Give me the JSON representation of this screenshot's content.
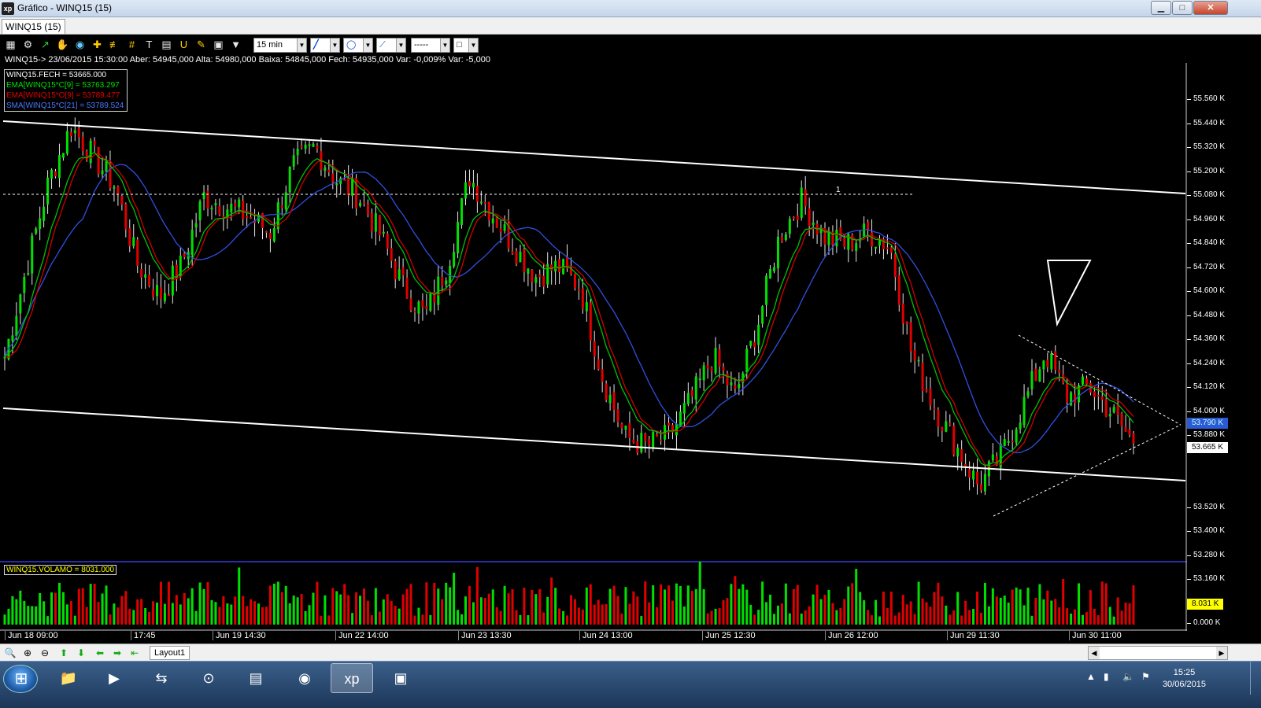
{
  "window": {
    "title": "Gráfico - WINQ15 (15)",
    "logo": "xp",
    "minimize": "▁",
    "maximize": "□",
    "close": "✕"
  },
  "tab": {
    "label": "WINQ15 (15)"
  },
  "toolbar": {
    "icons": [
      "chart-icon",
      "gear-icon",
      "cursor-icon",
      "hand-icon",
      "zoom-region-icon",
      "crosshair-icon",
      "hline-icon",
      "grid-icon",
      "text-icon",
      "magnet-icon",
      "brush-icon",
      "calculator-icon",
      "clipboard-icon",
      "filter-icon"
    ],
    "interval": "15 min",
    "line_style": "-----"
  },
  "quote": {
    "text": "WINQ15-> 23/06/2015 15:30:00 Aber: 54945,000 Alta: 54980,000 Baixa: 54845,000 Fech: 54935,000 Var: -0,009% Var: -5,000"
  },
  "legend": [
    {
      "text": "WINQ15.FECH = 53665.000",
      "color": "#ffffff"
    },
    {
      "text": "EMA[WINQ15*C[9] = 53763.297",
      "color": "#00e000"
    },
    {
      "text": "EMA[WINQ15*O[9] = 53789.477",
      "color": "#e00000"
    },
    {
      "text": "SMA[WINQ15*C[21] = 53789.524",
      "color": "#3a6cff"
    }
  ],
  "volume_legend": "WINQ15.VOLAMO = 8031.000",
  "price_axis": [
    "55.560 K",
    "55.440 K",
    "55.320 K",
    "55.200 K",
    "55.080 K",
    "54.960 K",
    "54.840 K",
    "54.720 K",
    "54.600 K",
    "54.480 K",
    "54.360 K",
    "54.240 K",
    "54.120 K",
    "54.000 K",
    "53.880 K",
    "53.520 K",
    "53.400 K",
    "53.280 K",
    "53.160 K"
  ],
  "price_tags": {
    "sma": "53.790 K",
    "last": "53.665 K",
    "volume": "8.031 K",
    "volume_zero": "0.000 K"
  },
  "marker_label": "1",
  "x_labels": [
    "Jun 18 09:00",
    "17:45",
    "Jun 19 14:30",
    "Jun 22 14:00",
    "Jun 23 13:30",
    "Jun 24 13:00",
    "Jun 25 12:30",
    "Jun 26 12:00",
    "Jun 29 11:30",
    "Jun 30 11:00"
  ],
  "bottom": {
    "layout_tab": "Layout1"
  },
  "taskbar": {
    "time": "15:25",
    "date": "30/06/2015"
  },
  "colors": {
    "up": "#00e000",
    "down": "#e00000",
    "ema_close": "#00c000",
    "ema_open": "#d00000",
    "sma": "#3050e0",
    "background": "#000000"
  },
  "chart_data": {
    "type": "candlestick",
    "symbol": "WINQ15",
    "interval": "15 min",
    "ylim": [
      53100,
      55600
    ],
    "x": [
      "Jun 18 09:00",
      "17:45",
      "Jun 19 14:30",
      "Jun 22 14:00",
      "Jun 23 13:30",
      "Jun 24 13:00",
      "Jun 25 12:30",
      "Jun 26 12:00",
      "Jun 29 11:30",
      "Jun 30 11:00"
    ],
    "close_path": [
      54100,
      54550,
      54980,
      55250,
      55100,
      54950,
      54560,
      54400,
      54560,
      54900,
      54850,
      54800,
      54720,
      55050,
      55150,
      54980,
      54900,
      54700,
      54450,
      54300,
      54560,
      55000,
      54820,
      54650,
      54500,
      54550,
      54450,
      54000,
      53700,
      53650,
      53700,
      53880,
      54100,
      53900,
      54250,
      54700,
      54880,
      54700,
      54660,
      54720,
      54650,
      54100,
      53850,
      53650,
      53450,
      53600,
      53850,
      54120,
      53900,
      53950,
      53820,
      53665
    ],
    "last_close": 53665,
    "ema9_close": 53763.297,
    "ema9_open": 53789.477,
    "sma21_close": 53789.524,
    "volume_last": 8031,
    "annotations": [
      "upper trend channel line",
      "lower trend channel line",
      "dotted horizontal resistance ~54970",
      "symmetrical triangle (dotted)",
      "downward triangle marker"
    ]
  }
}
